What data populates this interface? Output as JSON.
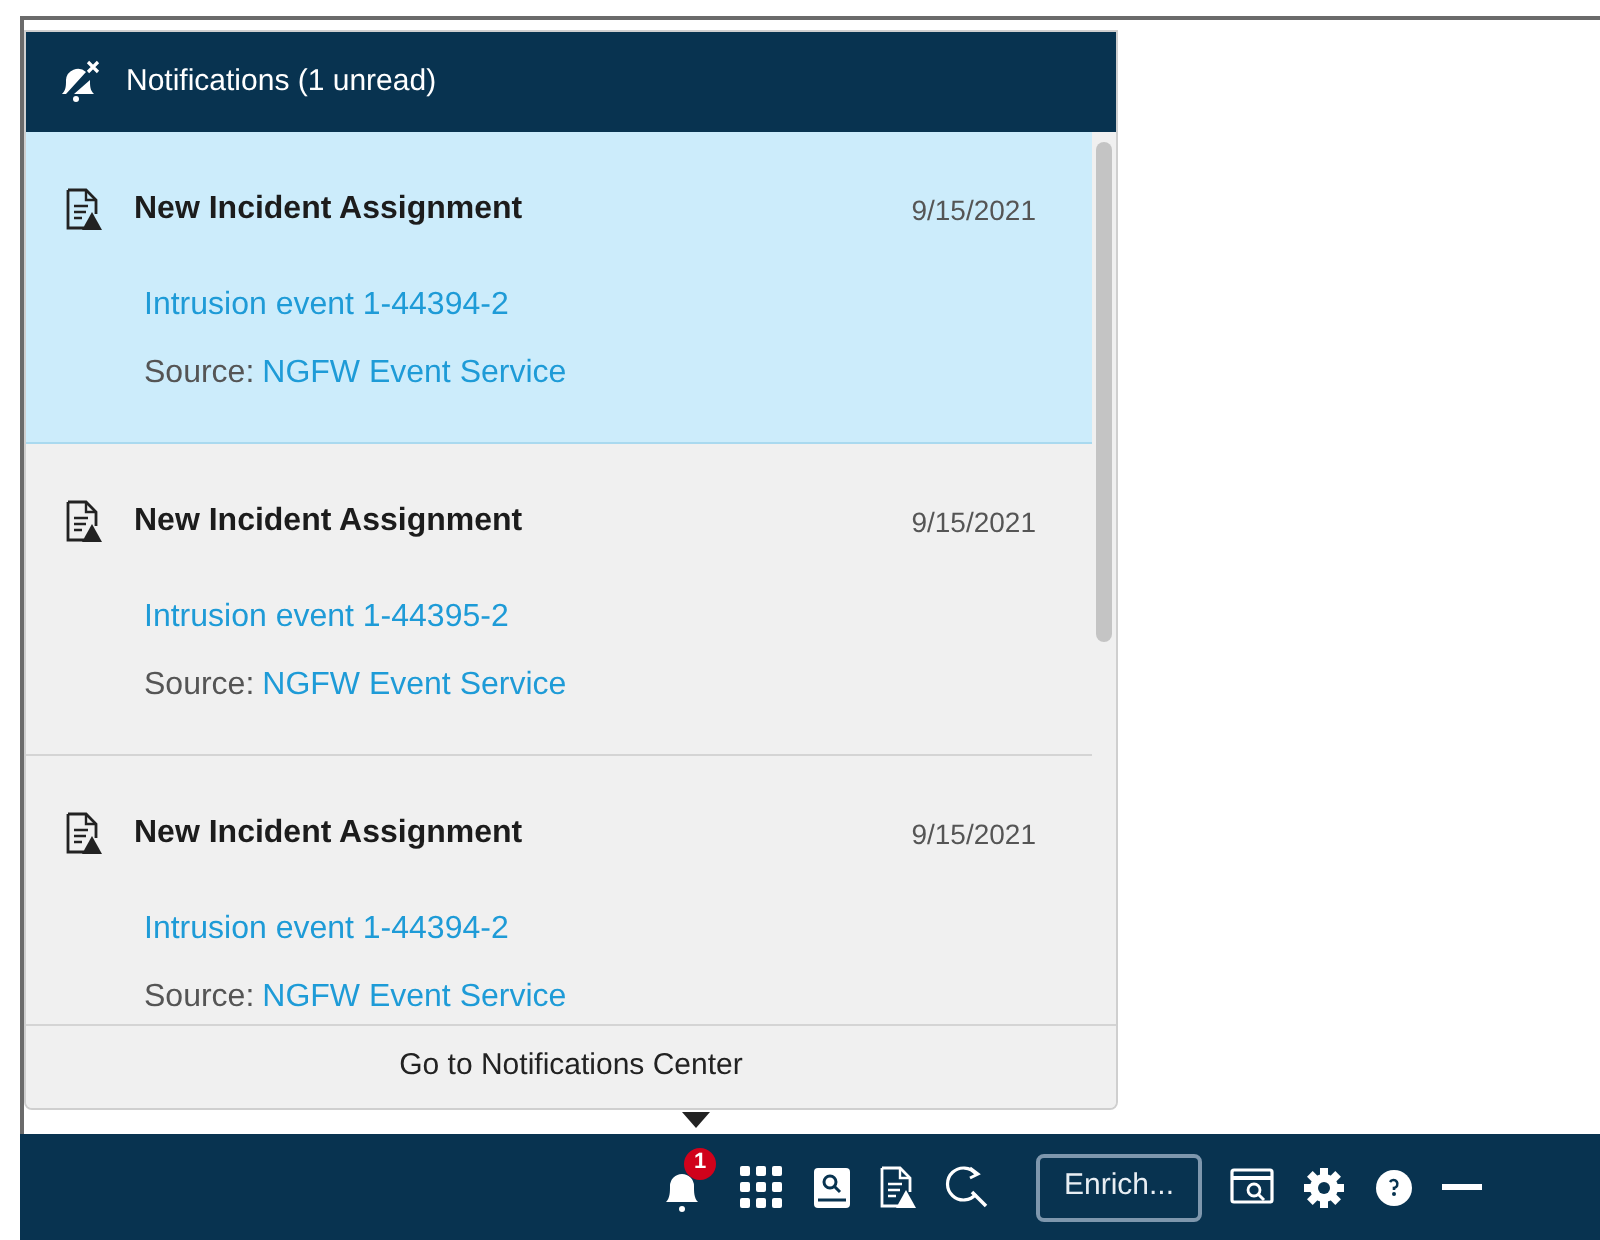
{
  "panel": {
    "title": "Notifications (1 unread)",
    "footer_link": "Go to Notifications Center"
  },
  "notifications": [
    {
      "title": "New Incident Assignment",
      "date": "9/15/2021",
      "event": "Intrusion event 1-44394-2",
      "source_label": "Source:",
      "source": "NGFW Event Service",
      "unread": true
    },
    {
      "title": "New Incident Assignment",
      "date": "9/15/2021",
      "event": "Intrusion event 1-44395-2",
      "source_label": "Source:",
      "source": "NGFW Event Service",
      "unread": false
    },
    {
      "title": "New Incident Assignment",
      "date": "9/15/2021",
      "event": "Intrusion event 1-44394-2",
      "source_label": "Source:",
      "source": "NGFW Event Service",
      "unread": false
    }
  ],
  "toolbar": {
    "bell_badge": "1",
    "enrich_button": "Enrich..."
  }
}
